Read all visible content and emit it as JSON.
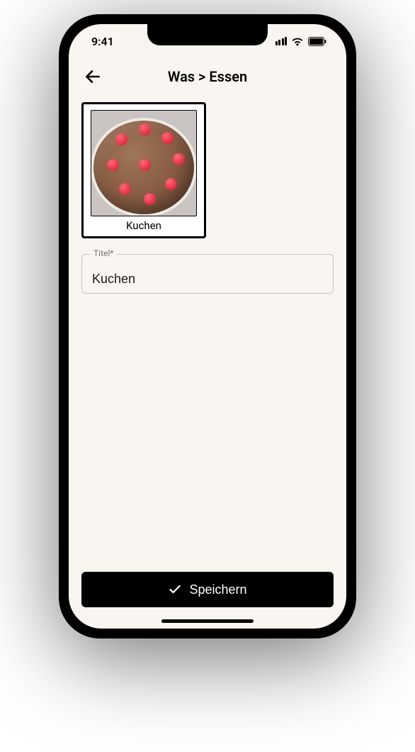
{
  "status": {
    "time": "9:41"
  },
  "header": {
    "breadcrumb": "Was > Essen"
  },
  "card": {
    "label": "Kuchen"
  },
  "form": {
    "title_label": "Titel*",
    "title_value": "Kuchen"
  },
  "actions": {
    "save_label": "Speichern"
  }
}
